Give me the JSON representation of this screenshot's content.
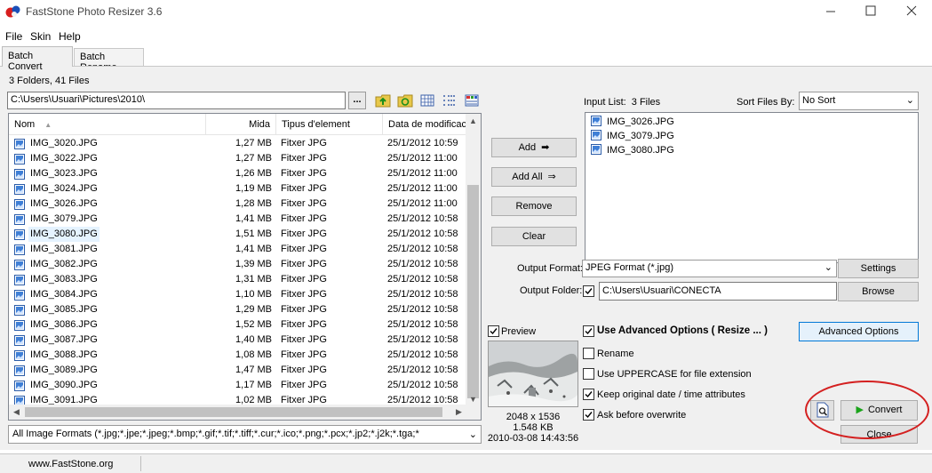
{
  "window": {
    "title": "FastStone Photo Resizer 3.6"
  },
  "menu": [
    "File",
    "Skin",
    "Help"
  ],
  "tabs": [
    {
      "label": "Batch Convert",
      "active": true
    },
    {
      "label": "Batch Rename",
      "active": false
    }
  ],
  "browser": {
    "summary": "3 Folders, 41 Files",
    "path": "C:\\Users\\Usuari\\Pictures\\2010\\",
    "browse_label": "...",
    "toolbar_icons": [
      "folder-up-icon",
      "refresh-folder-icon",
      "thumbnail-view-icon",
      "list-view-icon",
      "details-view-icon"
    ]
  },
  "file_list": {
    "columns": [
      "Nom",
      "Mida",
      "Tipus d'element",
      "Data de modificació"
    ],
    "rows": [
      {
        "name": "IMG_3020.JPG",
        "size": "1,27 MB",
        "type": "Fitxer JPG",
        "date": "25/1/2012 10:59"
      },
      {
        "name": "IMG_3022.JPG",
        "size": "1,27 MB",
        "type": "Fitxer JPG",
        "date": "25/1/2012 11:00"
      },
      {
        "name": "IMG_3023.JPG",
        "size": "1,26 MB",
        "type": "Fitxer JPG",
        "date": "25/1/2012 11:00"
      },
      {
        "name": "IMG_3024.JPG",
        "size": "1,19 MB",
        "type": "Fitxer JPG",
        "date": "25/1/2012 11:00"
      },
      {
        "name": "IMG_3026.JPG",
        "size": "1,28 MB",
        "type": "Fitxer JPG",
        "date": "25/1/2012 11:00"
      },
      {
        "name": "IMG_3079.JPG",
        "size": "1,41 MB",
        "type": "Fitxer JPG",
        "date": "25/1/2012 10:58"
      },
      {
        "name": "IMG_3080.JPG",
        "size": "1,51 MB",
        "type": "Fitxer JPG",
        "date": "25/1/2012 10:58"
      },
      {
        "name": "IMG_3081.JPG",
        "size": "1,41 MB",
        "type": "Fitxer JPG",
        "date": "25/1/2012 10:58"
      },
      {
        "name": "IMG_3082.JPG",
        "size": "1,39 MB",
        "type": "Fitxer JPG",
        "date": "25/1/2012 10:58"
      },
      {
        "name": "IMG_3083.JPG",
        "size": "1,31 MB",
        "type": "Fitxer JPG",
        "date": "25/1/2012 10:58"
      },
      {
        "name": "IMG_3084.JPG",
        "size": "1,10 MB",
        "type": "Fitxer JPG",
        "date": "25/1/2012 10:58"
      },
      {
        "name": "IMG_3085.JPG",
        "size": "1,29 MB",
        "type": "Fitxer JPG",
        "date": "25/1/2012 10:58"
      },
      {
        "name": "IMG_3086.JPG",
        "size": "1,52 MB",
        "type": "Fitxer JPG",
        "date": "25/1/2012 10:58"
      },
      {
        "name": "IMG_3087.JPG",
        "size": "1,40 MB",
        "type": "Fitxer JPG",
        "date": "25/1/2012 10:58"
      },
      {
        "name": "IMG_3088.JPG",
        "size": "1,08 MB",
        "type": "Fitxer JPG",
        "date": "25/1/2012 10:58"
      },
      {
        "name": "IMG_3089.JPG",
        "size": "1,47 MB",
        "type": "Fitxer JPG",
        "date": "25/1/2012 10:58"
      },
      {
        "name": "IMG_3090.JPG",
        "size": "1,17 MB",
        "type": "Fitxer JPG",
        "date": "25/1/2012 10:58"
      },
      {
        "name": "IMG_3091.JPG",
        "size": "1,02 MB",
        "type": "Fitxer JPG",
        "date": "25/1/2012 10:58"
      }
    ],
    "selected_index": 6,
    "format_filter": "All Image Formats (*.jpg;*.jpe;*.jpeg;*.bmp;*.gif;*.tif;*.tiff;*.cur;*.ico;*.png;*.pcx;*.jp2;*.j2k;*.tga;*"
  },
  "actions": {
    "add": "Add",
    "add_all": "Add All",
    "remove": "Remove",
    "clear": "Clear"
  },
  "input_list": {
    "label": "Input List:",
    "count": "3 Files",
    "sort_label": "Sort Files By:",
    "sort_value": "No Sort",
    "items": [
      "IMG_3026.JPG",
      "IMG_3079.JPG",
      "IMG_3080.JPG"
    ]
  },
  "output": {
    "format_label": "Output Format:",
    "format_value": "JPEG Format (*.jpg)",
    "settings_label": "Settings",
    "folder_label": "Output Folder:",
    "folder_checked": true,
    "folder_value": "C:\\Users\\Usuari\\CONECTA",
    "browse_label": "Browse"
  },
  "options": {
    "advanced": {
      "label": "Use Advanced Options ( Resize ... )",
      "checked": true
    },
    "advanced_button": "Advanced Options",
    "rename": {
      "label": "Rename",
      "checked": false
    },
    "uppercase": {
      "label": "Use UPPERCASE for file extension",
      "checked": false
    },
    "keep_date": {
      "label": "Keep original date / time attributes",
      "checked": true
    },
    "ask_overwrite": {
      "label": "Ask before overwrite",
      "checked": true
    }
  },
  "preview": {
    "label": "Preview",
    "checked": true,
    "dimensions": "2048 x 1536",
    "filesize": "1.548 KB",
    "datetime": "2010-03-08 14:43:56"
  },
  "footer_buttons": {
    "convert": "Convert",
    "close": "Close"
  },
  "status": {
    "text": "www.FastStone.org"
  },
  "colors": {
    "accent_ring": "#d42020",
    "selected_row": "#e5f3ff",
    "convert_play": "#1aa31a"
  }
}
